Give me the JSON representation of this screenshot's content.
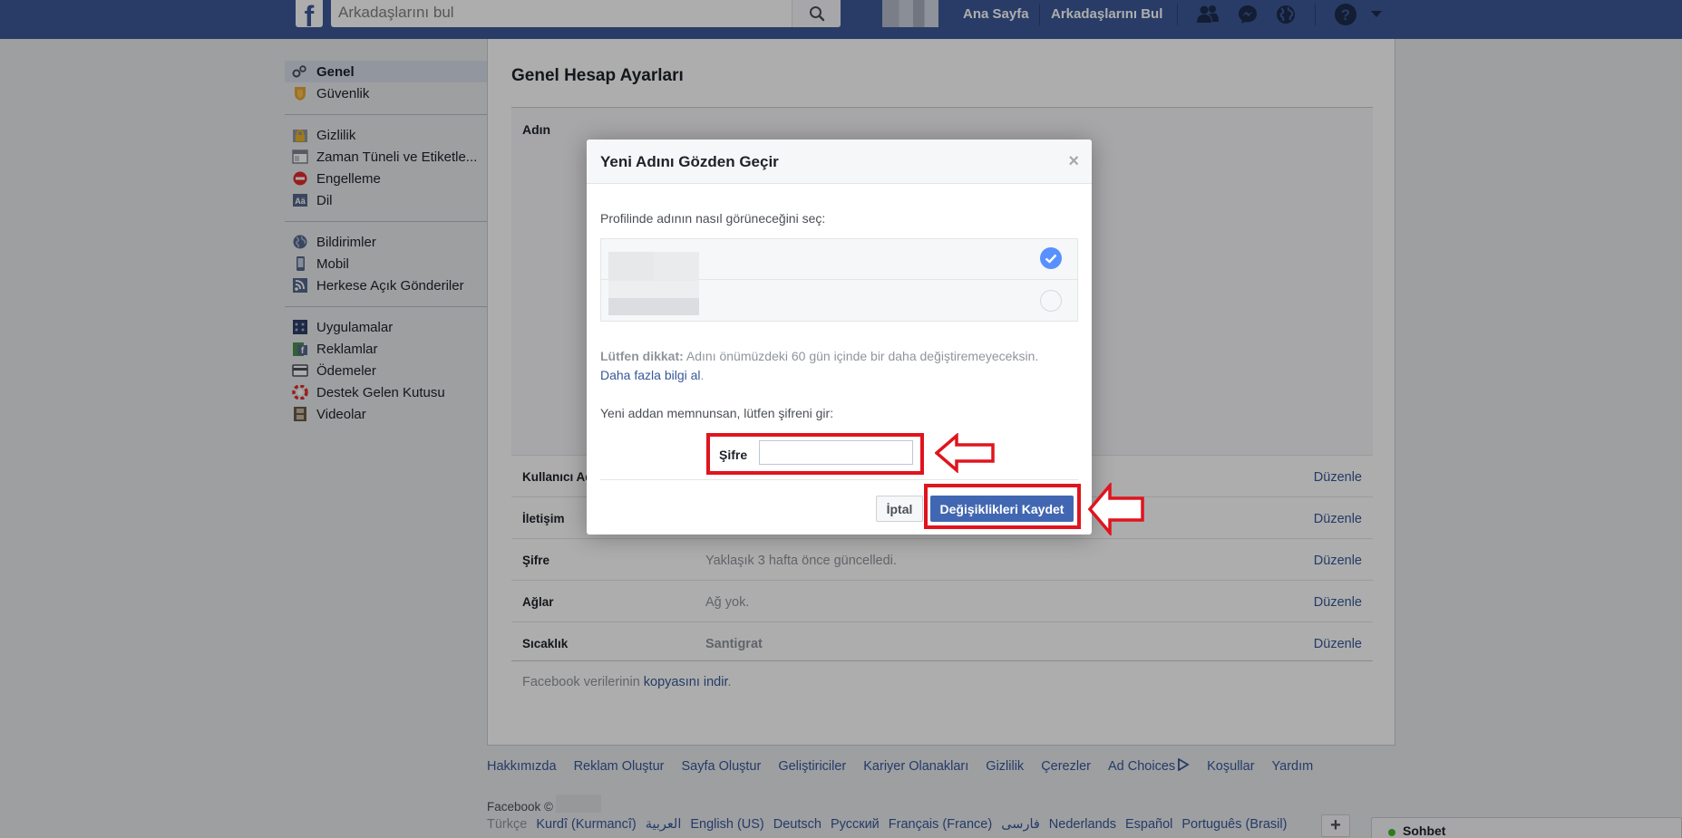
{
  "topbar": {
    "logo_letter": "f",
    "search_placeholder": "Arkadaşlarını bul",
    "home_label": "Ana Sayfa",
    "find_friends_label": "Arkadaşlarını Bul"
  },
  "sidebar": {
    "items": [
      {
        "label": "Genel",
        "icon": "gears-icon"
      },
      {
        "label": "Güvenlik",
        "icon": "badge-icon"
      },
      {
        "label": "Gizlilik",
        "icon": "lock-icon"
      },
      {
        "label": "Zaman Tüneli ve Etiketle...",
        "icon": "timeline-icon"
      },
      {
        "label": "Engelleme",
        "icon": "block-icon"
      },
      {
        "label": "Dil",
        "icon": "language-icon"
      },
      {
        "label": "Bildirimler",
        "icon": "globe-icon"
      },
      {
        "label": "Mobil",
        "icon": "phone-icon"
      },
      {
        "label": "Herkese Açık Gönderiler",
        "icon": "rss-icon"
      },
      {
        "label": "Uygulamalar",
        "icon": "apps-icon"
      },
      {
        "label": "Reklamlar",
        "icon": "ads-icon"
      },
      {
        "label": "Ödemeler",
        "icon": "card-icon"
      },
      {
        "label": "Destek Gelen Kutusu",
        "icon": "lifebuoy-icon"
      },
      {
        "label": "Videolar",
        "icon": "film-icon"
      }
    ]
  },
  "main": {
    "title": "Genel Hesap Ayarları",
    "name_label": "Adın",
    "rows": [
      {
        "label": "Kullanıcı Adı",
        "value": "",
        "edit": "Düzenle"
      },
      {
        "label": "İletişim",
        "value": "",
        "edit": "Düzenle"
      },
      {
        "label": "Şifre",
        "value": "Yaklaşık 3 hafta önce güncelledi.",
        "edit": "Düzenle"
      },
      {
        "label": "Ağlar",
        "value": "Ağ yok.",
        "edit": "Düzenle"
      },
      {
        "label": "Sıcaklık",
        "value": "Santigrat",
        "edit": "Düzenle"
      }
    ],
    "download_prefix": "Facebook verilerinin ",
    "download_link": "kopyasını indir",
    "download_suffix": "."
  },
  "modal": {
    "title": "Yeni Adını Gözden Geçir",
    "close": "×",
    "prompt": "Profilinde adının nasıl görüneceğini seç:",
    "note_bold": "Lütfen dikkat:",
    "note_text": " Adını önümüzdeki 60 gün içinde bir daha değiştiremeyeceksin.",
    "note_link": "Daha fazla bilgi al",
    "note_end": ".",
    "password_prompt": "Yeni addan memnunsan, lütfen şifreni gir:",
    "password_label": "Şifre",
    "password_value": "",
    "cancel_label": "İptal",
    "save_label": "Değişiklikleri Kaydet",
    "selected_choice": 0
  },
  "footer": {
    "links": [
      "Hakkımızda",
      "Reklam Oluştur",
      "Sayfa Oluştur",
      "Geliştiriciler",
      "Kariyer Olanakları",
      "Gizlilik",
      "Çerezler",
      "Ad Choices",
      "Koşullar",
      "Yardım"
    ],
    "copyright": "Facebook ©",
    "languages": [
      "Türkçe",
      "Kurdî (Kurmancî)",
      "العربية",
      "English (US)",
      "Deutsch",
      "Русский",
      "Français (France)",
      "فارسی",
      "Nederlands",
      "Español",
      "Português (Brasil)"
    ],
    "lang_add": "+"
  },
  "chat": {
    "label": "Sohbet"
  },
  "colors": {
    "brand": "#3b5998",
    "button": "#4267b2",
    "highlight": "#e0141e",
    "link": "#365899"
  }
}
